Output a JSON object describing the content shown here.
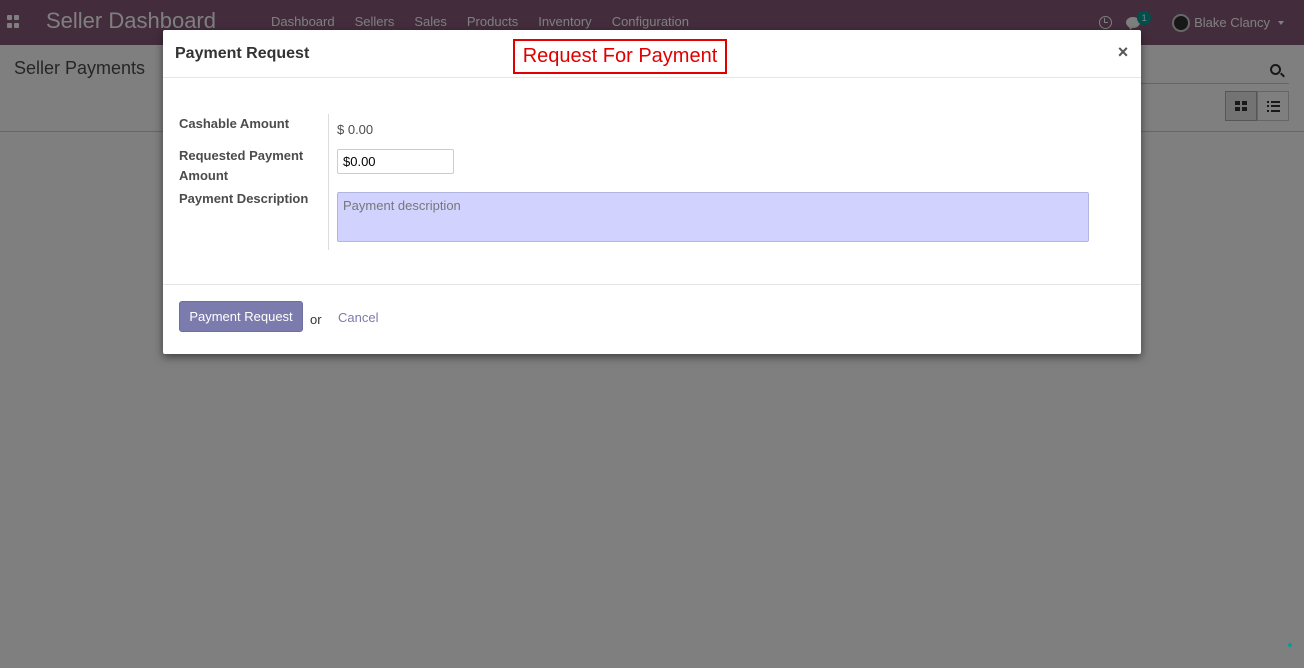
{
  "navbar": {
    "brand": "Seller Dashboard",
    "menu": [
      "Dashboard",
      "Sellers",
      "Sales",
      "Products",
      "Inventory",
      "Configuration"
    ],
    "chat_badge": "1",
    "user_name": "Blake Clancy"
  },
  "control_panel": {
    "title": "Seller Payments"
  },
  "dialog": {
    "title": "Payment Request",
    "annotation": "Request For Payment",
    "close_symbol": "×",
    "fields": {
      "cashable_label": "Cashable Amount",
      "cashable_value": "$ 0.00",
      "requested_label": "Requested Payment Amount",
      "requested_value": "$0.00",
      "description_label": "Payment Description",
      "description_placeholder": "Payment description"
    },
    "footer": {
      "submit_label": "Payment Request",
      "or_text": "or",
      "cancel_label": "Cancel"
    }
  },
  "colors": {
    "navbar": "#875a7b",
    "primary": "#7c7bad",
    "annotation": "#e00000",
    "textarea_bg": "#d2d2ff"
  }
}
